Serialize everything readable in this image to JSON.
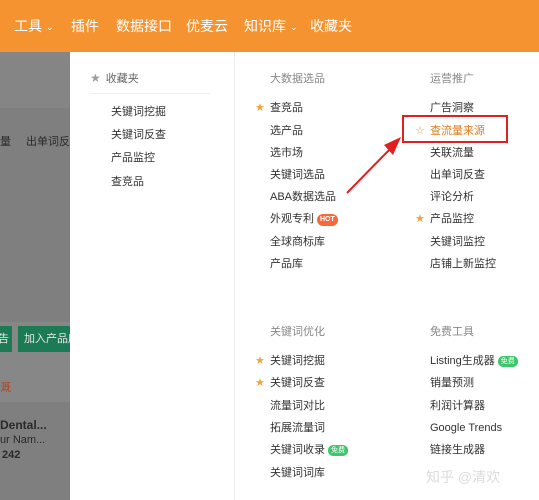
{
  "nav": {
    "items": [
      {
        "label": "工具",
        "dropdown": true
      },
      {
        "label": "插件",
        "dropdown": false
      },
      {
        "label": "数据接口",
        "dropdown": false
      },
      {
        "label": "优麦云",
        "dropdown": false
      },
      {
        "label": "知识库",
        "dropdown": true
      },
      {
        "label": "收藏夹",
        "dropdown": false
      }
    ],
    "caret": "⌄"
  },
  "background": {
    "texts": [
      "量",
      "出单词反查",
      "Dental...",
      "ur Nam...",
      "242",
      "溉"
    ],
    "buttons": [
      "告",
      "加入产品库"
    ]
  },
  "favorites": {
    "title": "收藏夹",
    "items": [
      "关键词挖掘",
      "关键词反查",
      "产品监控",
      "查竞品"
    ]
  },
  "sections": {
    "big_data": {
      "title": "大数据选品",
      "items": [
        {
          "label": "查竞品",
          "starred": true
        },
        {
          "label": "选产品",
          "starred": false
        },
        {
          "label": "选市场",
          "starred": false
        },
        {
          "label": "关键词选品",
          "starred": false
        },
        {
          "label": "ABA数据选品",
          "starred": false
        },
        {
          "label": "外观专利",
          "starred": false,
          "tag": "HOT"
        },
        {
          "label": "全球商标库",
          "starred": false
        },
        {
          "label": "产品库",
          "starred": false
        }
      ]
    },
    "operations": {
      "title": "运营推广",
      "items": [
        {
          "label": "广告洞察",
          "starred": false
        },
        {
          "label": "查流量来源",
          "starred": false,
          "highlighted": true
        },
        {
          "label": "关联流量",
          "starred": false
        },
        {
          "label": "出单词反查",
          "starred": false
        },
        {
          "label": "评论分析",
          "starred": false
        },
        {
          "label": "产品监控",
          "starred": true
        },
        {
          "label": "关键词监控",
          "starred": false
        },
        {
          "label": "店铺上新监控",
          "starred": false
        }
      ]
    },
    "keyword_opt": {
      "title": "关键词优化",
      "items": [
        {
          "label": "关键词挖掘",
          "starred": true
        },
        {
          "label": "关键词反查",
          "starred": true
        },
        {
          "label": "流量词对比",
          "starred": false
        },
        {
          "label": "拓展流量词",
          "starred": false
        },
        {
          "label": "关键词收录",
          "starred": false,
          "tag": "免费"
        },
        {
          "label": "关键词词库",
          "starred": false
        }
      ]
    },
    "free_tools": {
      "title": "免费工具",
      "items": [
        {
          "label": "Listing生成器",
          "starred": false,
          "tag": "免费"
        },
        {
          "label": "销量预测",
          "starred": false
        },
        {
          "label": "利润计算器",
          "starred": false
        },
        {
          "label": "Google Trends",
          "starred": false
        },
        {
          "label": "链接生成器",
          "starred": false
        }
      ]
    }
  },
  "watermark": "知乎 @清欢",
  "colors": {
    "topbar": "#f59331",
    "star": "#f3a33a",
    "highlight": "#e02020",
    "hot_tag": "#f46a3a",
    "free_tag": "#3ec66a"
  }
}
